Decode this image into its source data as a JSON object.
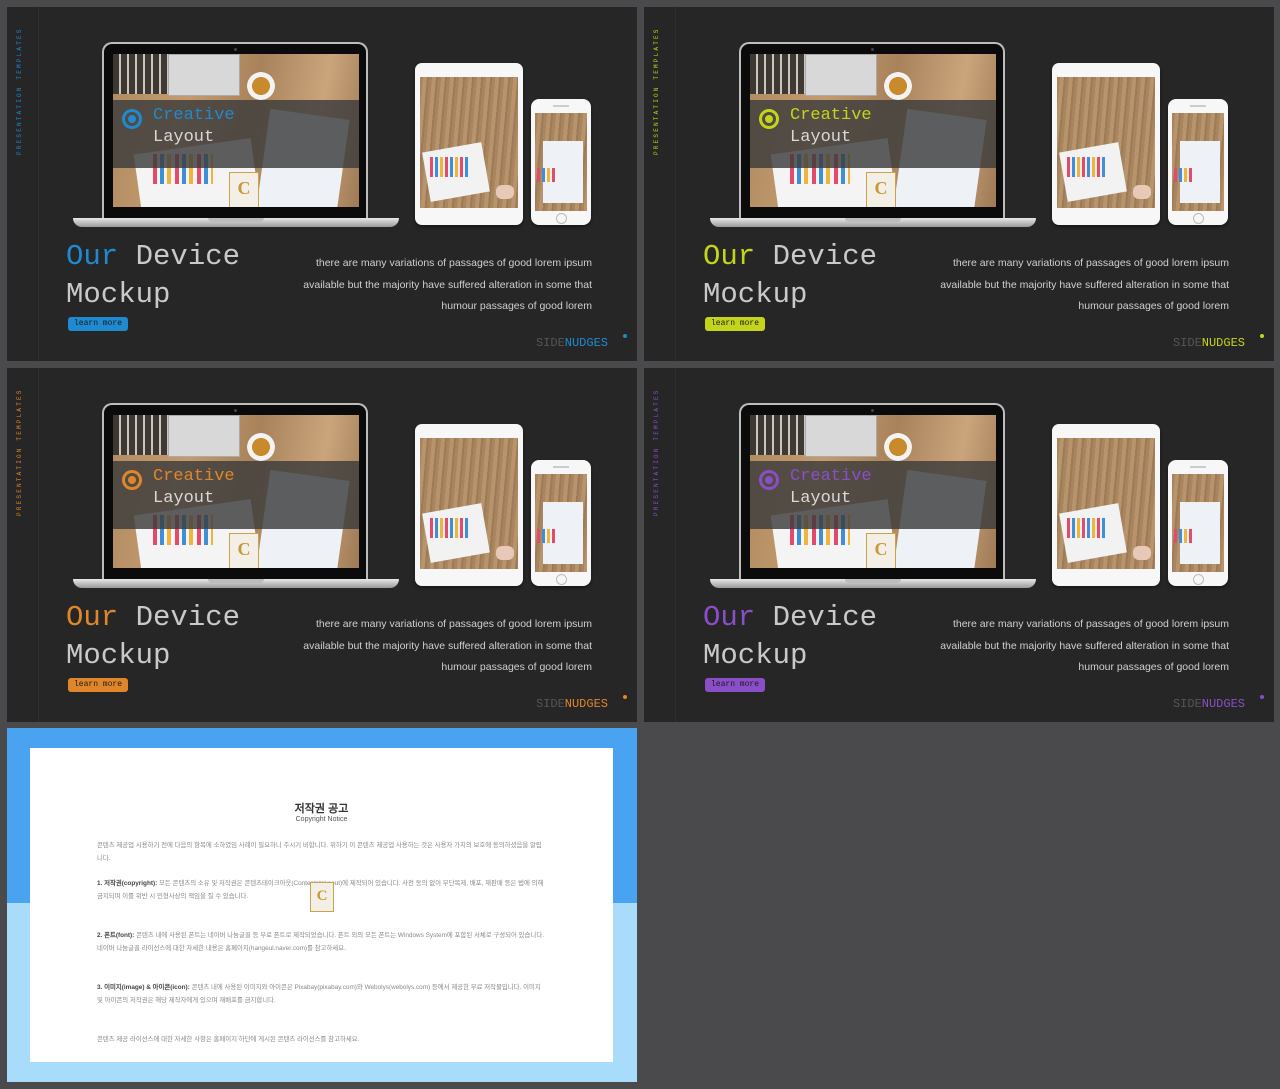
{
  "slides": [
    {
      "accent": "#1f8ad0",
      "side_text": "PRESENTATION TEMPLATES",
      "screen_title": "Creative",
      "screen_subtitle": "Layout",
      "title_word1": "Our",
      "title_word2": " Device",
      "title_line2": "Mockup",
      "button": "learn more",
      "paragraph": [
        "there are many variations of passages of good lorem ipsum",
        "available but the majority have suffered alteration in some that",
        "humour passages of good lorem"
      ],
      "brand_a": "SIDE",
      "brand_b": "NUDGES"
    },
    {
      "accent": "#c4d41a",
      "side_text": "PRESENTATION TEMPLATES",
      "screen_title": "Creative",
      "screen_subtitle": "Layout",
      "title_word1": "Our",
      "title_word2": " Device",
      "title_line2": "Mockup",
      "button": "learn more",
      "paragraph": [
        "there are many variations of passages of good lorem ipsum",
        "available but the majority have suffered alteration in some that",
        "humour passages of good lorem"
      ],
      "brand_a": "SIDE",
      "brand_b": "NUDGES"
    },
    {
      "accent": "#e0862a",
      "side_text": "PRESENTATION TEMPLATES",
      "screen_title": "Creative",
      "screen_subtitle": "Layout",
      "title_word1": "Our",
      "title_word2": " Device",
      "title_line2": "Mockup",
      "button": "learn more",
      "paragraph": [
        "there are many variations of passages of good lorem ipsum",
        "available but the majority have suffered alteration in some that",
        "humour passages of good lorem"
      ],
      "brand_a": "SIDE",
      "brand_b": "NUDGES"
    },
    {
      "accent": "#8a4ec7",
      "side_text": "PRESENTATION TEMPLATES",
      "screen_title": "Creative",
      "screen_subtitle": "Layout",
      "title_word1": "Our",
      "title_word2": " Device",
      "title_line2": "Mockup",
      "button": "learn more",
      "paragraph": [
        "there are many variations of passages of good lorem ipsum",
        "available but the majority have suffered alteration in some that",
        "humour passages of good lorem"
      ],
      "brand_a": "SIDE",
      "brand_b": "NUDGES"
    }
  ],
  "copyright": {
    "title": "저작권 공고",
    "subtitle": "Copyright Notice",
    "p1": "콘텐츠 제공업 시용하기 전에 다음의 항목에 소하였임 사례이 필요하니 주시기 비합니다. 위하기 이 콘텐츠 제공업 사용하는 것은 사용자 가치의 보호에 동의하셨음을 알립니다.",
    "p2_head": "1. 저작권(copyright):",
    "p2": " 모든 콘텐츠의 소유 및 저작권은 콘텐츠테이크아웃(Contentstakeout)에 제작되어 있습니다. 사전 동의 없이 무단복제, 배포, 재판매 등은 법에 의해 금지되며 이를 위반 시 민형사상의 책임을 질 수 있습니다.",
    "p3_head": "2. 폰트(font):",
    "p3": " 콘텐츠 내에 사용된 폰트는 네이버 나눔글꼴 등 무료 폰트로 제작되었습니다. 폰트 외의 모든 폰트는 Windows System에 포함된 서체로 구성되어 있습니다. 네이버 나눔글꼴 라이선스에 대한 자세한 내용은 홈페이지(hangeul.naver.com)를 참고하세요.",
    "p4_head": "3. 이미지(image) & 아이콘(icon):",
    "p4": " 콘텐츠 내에 사용된 이미지와 아이콘은 Pixabay(pixabay.com)와 Webolys(webolys.com) 등에서 제공한 무료 저작물입니다. 이미지 및 아이콘의 저작권은 해당 제작자에게 있으며 재배포를 금지합니다.",
    "p5": "콘텐츠 제공 라이선스에 대한 자세한 사항은 홈페이지 하단에 게시된 콘텐츠 라이선스를 참고하세요."
  }
}
